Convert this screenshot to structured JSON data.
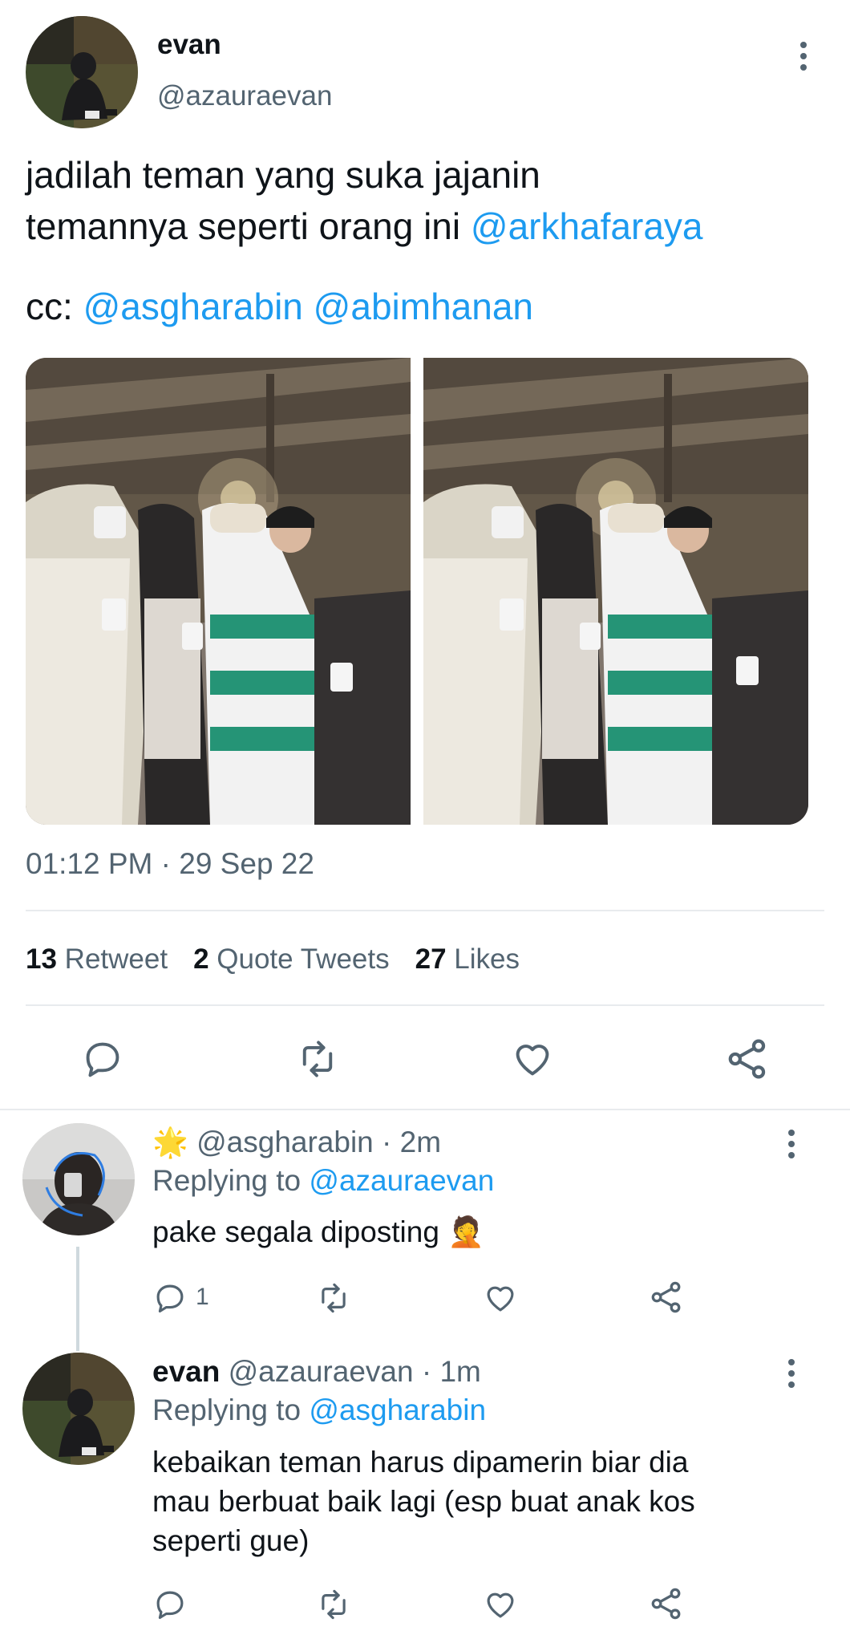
{
  "tweet": {
    "author_name": "evan",
    "author_handle": "@azauraevan",
    "text_line1": "jadilah teman yang suka jajanin",
    "text_line2_prefix": "temannya seperti orang ini ",
    "text_line2_mention": "@arkhafaraya",
    "cc_prefix": "cc: ",
    "cc_mention1": "@asgharabin",
    "cc_mention2": "@abimhanan",
    "timestamp": "01:12 PM · 29 Sep 22",
    "stats": {
      "retweets_count": "13",
      "retweets_label": "Retweet",
      "quotes_count": "2",
      "quotes_label": "Quote Tweets",
      "likes_count": "27",
      "likes_label": "Likes"
    }
  },
  "replies": [
    {
      "badge": "🌟",
      "handle": "@asgharabin",
      "time": "· 2m",
      "replying_label": "Replying to ",
      "replying_to": "@azauraevan",
      "text": "pake segala diposting",
      "emoji": "🤦",
      "reply_count": "1"
    },
    {
      "name": "evan",
      "handle": "@azauraevan",
      "time": "· 1m",
      "replying_label": "Replying to ",
      "replying_to": "@asgharabin",
      "text_line1": "kebaikan teman harus dipamerin biar dia",
      "text_line2": "mau berbuat baik lagi (esp buat anak kos",
      "text_line3": "seperti gue)"
    }
  ],
  "icons": {
    "reply": "reply-icon",
    "retweet": "retweet-icon",
    "like": "heart-icon",
    "share": "share-icon",
    "more": "more-vertical-icon"
  },
  "colors": {
    "link": "#1d9bf0",
    "muted": "#536471",
    "text": "#0f1419",
    "divider": "#e8ebee"
  }
}
